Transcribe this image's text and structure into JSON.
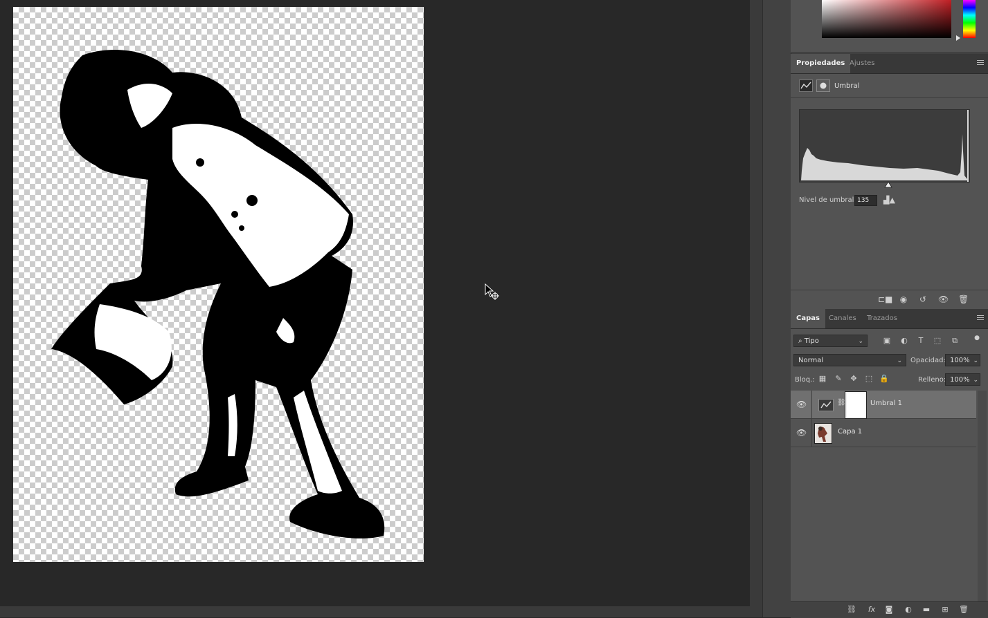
{
  "properties_panel": {
    "tabs": [
      {
        "label": "Propiedades",
        "active": true
      },
      {
        "label": "Ajustes",
        "active": false
      }
    ],
    "adjustment_title": "Umbral",
    "threshold_label": "Nivel de umbral:",
    "threshold_value": "135"
  },
  "layers_panel": {
    "tabs": [
      {
        "label": "Capas",
        "active": true
      },
      {
        "label": "Canales",
        "active": false
      },
      {
        "label": "Trazados",
        "active": false
      }
    ],
    "filter_kind": "Tipo",
    "blend_mode": "Normal",
    "opacity_label": "Opacidad:",
    "opacity_value": "100%",
    "lock_label": "Bloq.:",
    "fill_label": "Relleno:",
    "fill_value": "100%",
    "layers": [
      {
        "name": "Umbral 1",
        "selected": true,
        "visible": true
      },
      {
        "name": "Capa 1",
        "selected": false,
        "visible": true
      }
    ]
  },
  "colors": {
    "workspace_bg": "#282828",
    "panel_bg": "#535353",
    "selected_layer": "#707070",
    "foreground_red": "#c01f24"
  }
}
